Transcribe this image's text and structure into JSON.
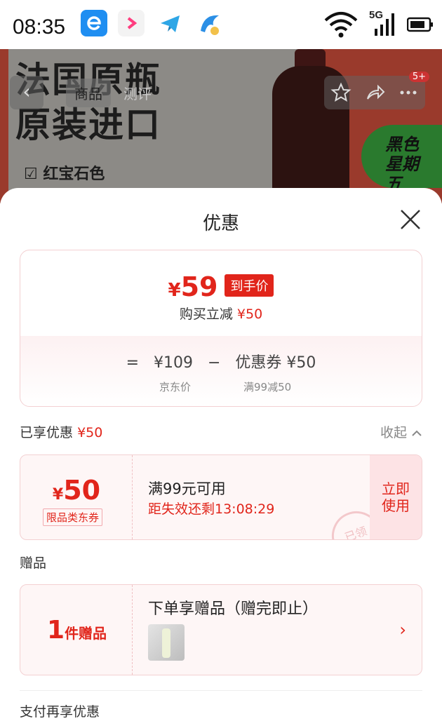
{
  "status": {
    "time": "08:35",
    "network": "5G"
  },
  "hero": {
    "line1": "法国原瓶",
    "line2": "原装进口",
    "check_label": "红宝石色",
    "promo_label": "黑色星期五"
  },
  "nav": {
    "tabs": [
      "商品",
      "测评"
    ],
    "badge": "5+"
  },
  "sheet": {
    "title": "优惠",
    "price": {
      "yen": "¥",
      "final": "59",
      "tag": "到手价",
      "reduce_text": "购买立减",
      "reduce_amount": "¥50",
      "formula_eq": "=",
      "base": "¥109",
      "minus": "−",
      "coupon_part": "优惠券 ¥50",
      "base_sub": "京东价",
      "coupon_sub": "满99减50"
    },
    "enjoyed_label": "已享优惠",
    "enjoyed_amount": "¥50",
    "collapse_label": "收起",
    "coupon": {
      "yen": "¥",
      "amount": "50",
      "limit": "限品类东券",
      "condition": "满99元可用",
      "expire": "距失效还剩13:08:29",
      "use_line1": "立即",
      "use_line2": "使用",
      "stamp": "已领"
    },
    "gift_header": "赠品",
    "gift": {
      "count": "1",
      "count_unit": "件赠品",
      "title": "下单享赠品（赠完即止）"
    },
    "pay_header": "支付再享优惠"
  }
}
